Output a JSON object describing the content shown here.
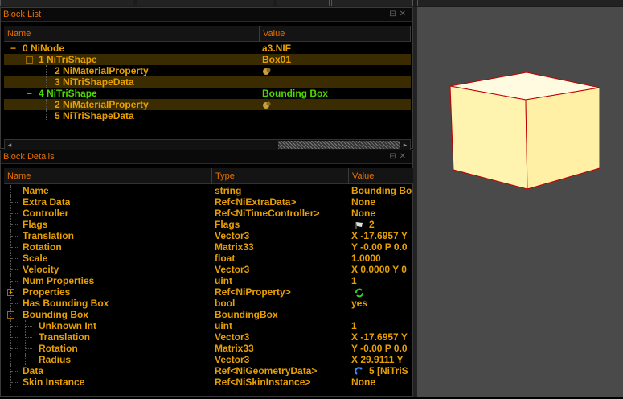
{
  "block_list": {
    "title": "Block List",
    "columns": [
      "Name",
      "Value"
    ],
    "rows": [
      {
        "name": "0 NiNode",
        "value": "a3.NIF",
        "depth": 0,
        "expander": "minus",
        "green": false
      },
      {
        "name": "1 NiTriShape",
        "value": "Box01",
        "depth": 1,
        "expander": "box-minus",
        "green": false,
        "selected": true
      },
      {
        "name": "2 NiMaterialProperty",
        "value": "",
        "depth": 2,
        "expander": "none",
        "green": false,
        "icon": "material-icon"
      },
      {
        "name": "3 NiTriShapeData",
        "value": "",
        "depth": 2,
        "expander": "none",
        "green": false,
        "selected": true
      },
      {
        "name": "4 NiTriShape",
        "value": "Bounding Box",
        "depth": 1,
        "expander": "minus",
        "green": true
      },
      {
        "name": "2 NiMaterialProperty",
        "value": "",
        "depth": 2,
        "expander": "none",
        "green": false,
        "icon": "material-icon",
        "selected": true
      },
      {
        "name": "5 NiTriShapeData",
        "value": "",
        "depth": 2,
        "expander": "none",
        "green": false
      }
    ]
  },
  "block_details": {
    "title": "Block Details",
    "columns": [
      "Name",
      "Type",
      "Value"
    ],
    "rows": [
      {
        "name": "Name",
        "type": "string",
        "value": "Bounding Bo",
        "depth": 0
      },
      {
        "name": "Extra Data",
        "type": "Ref<NiExtraData>",
        "value": "None",
        "depth": 0
      },
      {
        "name": "Controller",
        "type": "Ref<NiTimeController>",
        "value": "None",
        "depth": 0
      },
      {
        "name": "Flags",
        "type": "Flags",
        "value": "2",
        "depth": 0,
        "icon": "flag-icon"
      },
      {
        "name": "Translation",
        "type": "Vector3",
        "value": "X -17.6957 Y",
        "depth": 0
      },
      {
        "name": "Rotation",
        "type": "Matrix33",
        "value": "Y -0.00 P 0.0",
        "depth": 0
      },
      {
        "name": "Scale",
        "type": "float",
        "value": "1.0000",
        "depth": 0
      },
      {
        "name": "Velocity",
        "type": "Vector3",
        "value": "X 0.0000 Y 0",
        "depth": 0
      },
      {
        "name": "Num Properties",
        "type": "uint",
        "value": "1",
        "depth": 0
      },
      {
        "name": "Properties",
        "type": "Ref<NiProperty>",
        "value": "",
        "depth": 0,
        "expander": "plus",
        "icon": "refresh-icon"
      },
      {
        "name": "Has Bounding Box",
        "type": "bool",
        "value": "yes",
        "depth": 0
      },
      {
        "name": "Bounding Box",
        "type": "BoundingBox",
        "value": "",
        "depth": 0,
        "expander": "minus"
      },
      {
        "name": "Unknown Int",
        "type": "uint",
        "value": "1",
        "depth": 1
      },
      {
        "name": "Translation",
        "type": "Vector3",
        "value": "X -17.6957 Y",
        "depth": 1
      },
      {
        "name": "Rotation",
        "type": "Matrix33",
        "value": "Y -0.00 P 0.0",
        "depth": 1
      },
      {
        "name": "Radius",
        "type": "Vector3",
        "value": "X 29.9111 Y",
        "depth": 1
      },
      {
        "name": "Data",
        "type": "Ref<NiGeometryData>",
        "value": "5 [NiTriS",
        "depth": 0,
        "icon": "link-icon"
      },
      {
        "name": "Skin Instance",
        "type": "Ref<NiSkinInstance>",
        "value": "None",
        "depth": 0
      }
    ]
  },
  "colors": {
    "text": "#e8a000",
    "title": "#e87000",
    "green": "#4cd900",
    "selection": "#3a2c00",
    "viewport_bg": "#4a4a4a",
    "cube_fill": "#fff3b0",
    "cube_edge": "#c00000"
  }
}
